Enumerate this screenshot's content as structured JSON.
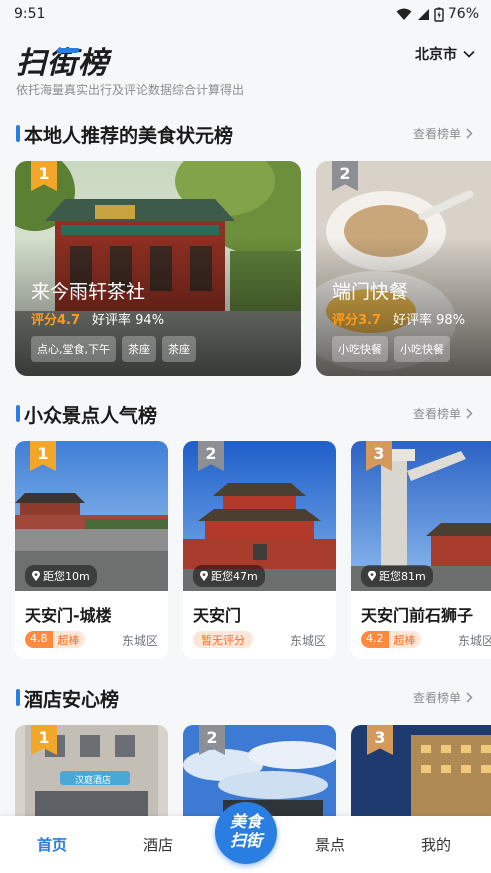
{
  "status": {
    "time": "9:51",
    "battery": "76%"
  },
  "header": {
    "logo": "扫街榜",
    "subtitle": "依托海量真实出行及评论数据综合计算得出",
    "city": "北京市"
  },
  "sections": {
    "food": {
      "title": "本地人推荐的美食状元榜",
      "more": "查看榜单"
    },
    "spots": {
      "title": "小众景点人气榜",
      "more": "查看榜单"
    },
    "hotels": {
      "title": "酒店安心榜",
      "more": "查看榜单"
    }
  },
  "food": [
    {
      "rank": "1",
      "name": "来今雨轩茶社",
      "score": "评分4.7",
      "good": "好评率 94%",
      "tags": [
        "点心,堂食,下午",
        "茶座",
        "茶座"
      ]
    },
    {
      "rank": "2",
      "name": "端门快餐",
      "score": "评分3.7",
      "good": "好评率 98%",
      "tags": [
        "小吃快餐",
        "小吃快餐"
      ]
    }
  ],
  "spots": [
    {
      "rank": "1",
      "distance": "距您10m",
      "name": "天安门-城楼",
      "rating": "4.8",
      "rating_text": "超棒",
      "district": "东城区"
    },
    {
      "rank": "2",
      "distance": "距您47m",
      "name": "天安门",
      "rating_none": "暂无评分",
      "district": "东城区"
    },
    {
      "rank": "3",
      "distance": "距您81m",
      "name": "天安门前石狮子",
      "rating": "4.2",
      "rating_text": "超棒",
      "district": "东城区"
    }
  ],
  "hotels": [
    {
      "rank": "1",
      "sign": "汉庭酒店"
    },
    {
      "rank": "2"
    },
    {
      "rank": "3"
    }
  ],
  "tabbar": {
    "home": "首页",
    "hotel": "酒店",
    "center": "美食扫街",
    "center_l1": "美食",
    "center_l2": "扫街",
    "spot": "景点",
    "mine": "我的"
  },
  "colors": {
    "accent": "#2a7de1",
    "score": "#ff9a1f",
    "rank_gold": "#f2a72a",
    "rank_gray": "#8c8f94",
    "rank_bronze": "#d49a5c"
  }
}
